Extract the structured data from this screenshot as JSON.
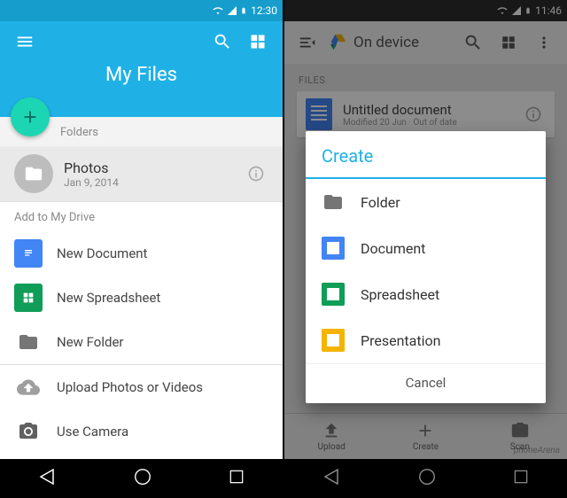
{
  "left": {
    "status_time": "12:30",
    "title": "My Files",
    "folders_label": "Folders",
    "folder": {
      "name": "Photos",
      "date": "Jan 9, 2014"
    },
    "add_label": "Add to My Drive",
    "actions": {
      "doc": "New Document",
      "sheet": "New Spreadsheet",
      "folder": "New Folder",
      "upload": "Upload Photos or Videos",
      "camera": "Use Camera"
    }
  },
  "right": {
    "status_time": "11:46",
    "title": "On device",
    "files_label": "FILES",
    "file": {
      "name": "Untitled document",
      "meta": "Modified 20 Jun · Out of date"
    },
    "dialog": {
      "title": "Create",
      "folder": "Folder",
      "doc": "Document",
      "sheet": "Spreadsheet",
      "slides": "Presentation",
      "cancel": "Cancel"
    },
    "tabs": {
      "upload": "Upload",
      "create": "Create",
      "scan": "Scan"
    }
  },
  "watermark": "phoneArena"
}
